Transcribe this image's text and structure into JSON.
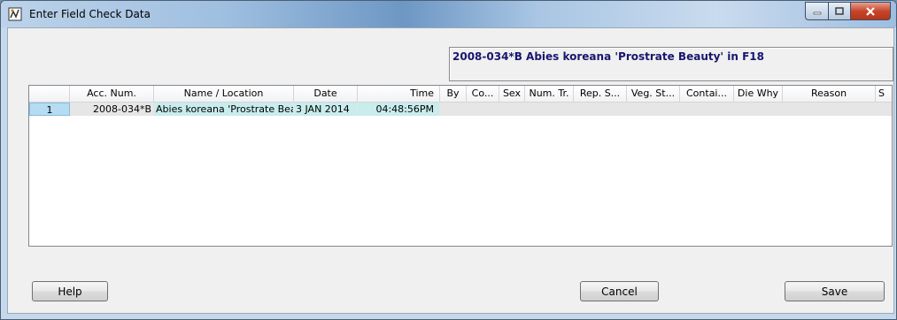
{
  "window": {
    "title": "Enter Field Check Data"
  },
  "info": {
    "text": "2008-034*B Abies koreana 'Prostrate Beauty' in F18"
  },
  "grid": {
    "columns": [
      "Acc. Num.",
      "Name / Location",
      "Date",
      "Time",
      "By",
      "Co...",
      "Sex",
      "Num. Tr.",
      "Rep. S...",
      "Veg. St...",
      "Contai...",
      "Die Why",
      "Reason",
      "S"
    ],
    "rows": [
      {
        "num": "1",
        "acc": "2008-034*B",
        "name": "Abies koreana 'Prostrate Beauty' in F18",
        "date": "3 JAN 2014",
        "time": "04:48:56PM"
      }
    ]
  },
  "buttons": {
    "help": "Help",
    "cancel": "Cancel",
    "save": "Save"
  },
  "icons": {
    "app": "field-check-icon",
    "minimize": "minimize-icon",
    "maximize": "maximize-icon",
    "close": "close-icon"
  },
  "colors": {
    "row_highlight": "#c9ecec",
    "info_text": "#16166e",
    "close_button": "#c7462b"
  }
}
